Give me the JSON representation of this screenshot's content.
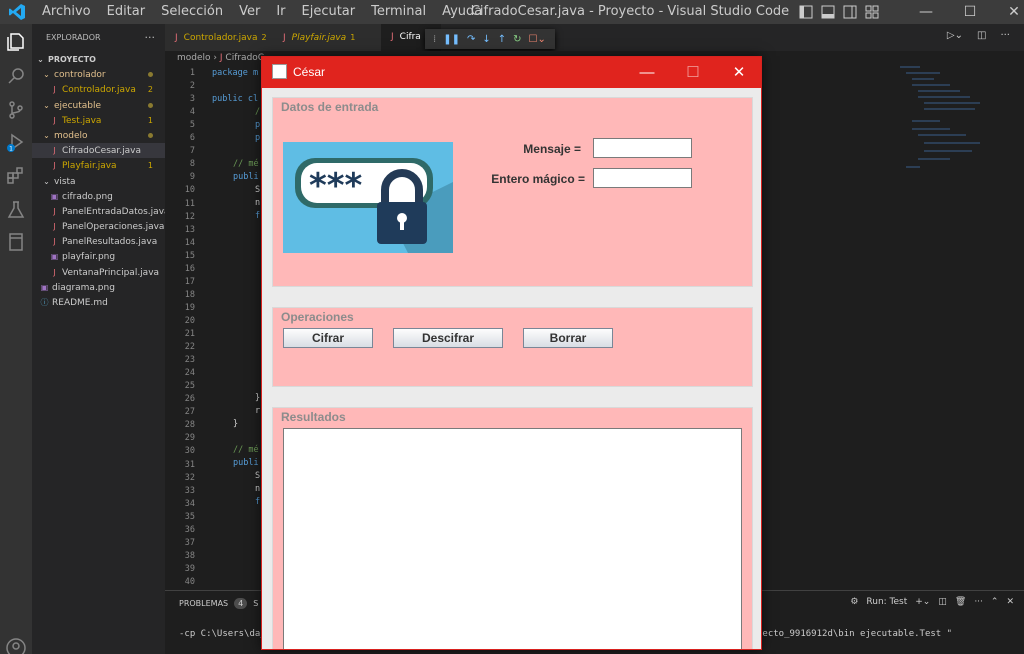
{
  "titlebar": {
    "menu": [
      "Archivo",
      "Editar",
      "Selección",
      "Ver",
      "Ir",
      "Terminal",
      "Ayuda"
    ],
    "run_menu": "Ejecutar",
    "window_title": "CifradoCesar.java - Proyecto - Visual Studio Code"
  },
  "sidebar": {
    "header": "EXPLORADOR",
    "more": "···",
    "project": "PROYECTO",
    "items": [
      {
        "label": "controlador",
        "type": "folder"
      },
      {
        "label": "Controlador.java",
        "type": "java",
        "badge": "2"
      },
      {
        "label": "ejecutable",
        "type": "folder"
      },
      {
        "label": "Test.java",
        "type": "java",
        "badge": "1"
      },
      {
        "label": "modelo",
        "type": "folder"
      },
      {
        "label": "CifradoCesar.java",
        "type": "java"
      },
      {
        "label": "Playfair.java",
        "type": "java",
        "badge": "1"
      },
      {
        "label": "vista",
        "type": "folder"
      },
      {
        "label": "cifrado.png",
        "type": "image"
      },
      {
        "label": "PanelEntradaDatos.java",
        "type": "java"
      },
      {
        "label": "PanelOperaciones.java",
        "type": "java"
      },
      {
        "label": "PanelResultados.java",
        "type": "java"
      },
      {
        "label": "playfair.png",
        "type": "image"
      },
      {
        "label": "VentanaPrincipal.java",
        "type": "java"
      },
      {
        "label": "diagrama.png",
        "type": "image"
      },
      {
        "label": "README.md",
        "type": "info"
      }
    ]
  },
  "tabs": [
    {
      "label": "Controlador.java",
      "badge": "2"
    },
    {
      "label": "Playfair.java",
      "badge": "1"
    },
    {
      "label": "Cifra"
    }
  ],
  "breadcrumb": {
    "folder": "modelo",
    "file": "CifradoC"
  },
  "code": {
    "line_numbers": [
      "1",
      "2",
      "3",
      "4",
      "5",
      "6",
      "7",
      "8",
      "9",
      "10",
      "11",
      "12",
      "13",
      "14",
      "15",
      "16",
      "17",
      "18",
      "19",
      "20",
      "21",
      "22",
      "23",
      "24",
      "25",
      "26",
      "27",
      "28",
      "29",
      "30",
      "31",
      "32",
      "33",
      "34",
      "35",
      "36",
      "37",
      "38",
      "39",
      "40"
    ],
    "l1": "package m",
    "l3": "public cl",
    "l4": "/",
    "l5": "p",
    "l6": "p",
    "l8": "// mé",
    "l9": "publi",
    "l10": "S",
    "l11": "n",
    "l12": "f",
    "l26": "}",
    "l27": "r",
    "l28": "}",
    "l30": "// mé",
    "l31": "publi",
    "l32": "S",
    "l33": "n",
    "l34": "f"
  },
  "panel": {
    "problems": "PROBLEMAS",
    "problems_count": "4",
    "second_tab": "S",
    "run_test": "Run: Test",
    "cmd_left": "-cp C:\\Users\\da_",
    "cmd_right": "yecto_9916912d\\bin ejecutable.Test \""
  },
  "swing": {
    "title": "César",
    "minimize": "—",
    "maximize": "☐",
    "close": "✕",
    "input_panel": {
      "title": "Datos de entrada",
      "mensaje_label": "Mensaje =",
      "entero_label": "Entero mágico =",
      "mensaje_value": "",
      "entero_value": "",
      "image_text": "***"
    },
    "ops_panel": {
      "title": "Operaciones",
      "cifrar": "Cifrar",
      "descifrar": "Descifrar",
      "borrar": "Borrar"
    },
    "results_panel": {
      "title": "Resultados",
      "text": ""
    }
  },
  "colors": {
    "swing_titlebar": "#e0241e",
    "panel_bg": "#ffb8b8",
    "vscode_accent": "#007acc"
  }
}
